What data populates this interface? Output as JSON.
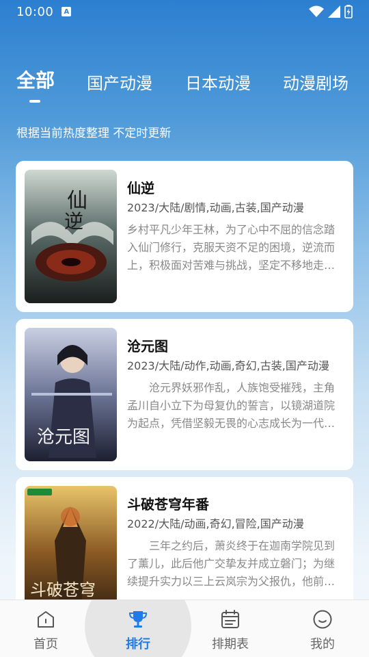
{
  "status_bar": {
    "time": "10:00",
    "notification_icon": "A"
  },
  "tabs": [
    {
      "label": "全部",
      "active": true
    },
    {
      "label": "国产动漫",
      "active": false
    },
    {
      "label": "日本动漫",
      "active": false
    },
    {
      "label": "动漫剧场",
      "active": false
    }
  ],
  "subtitle": "根据当前热度整理 不定时更新",
  "cards": [
    {
      "title": "仙逆",
      "meta": "2023/大陆/剧情,动画,古装,国产动漫",
      "description": "乡村平凡少年王林，为了心中不屈的信念踏入仙门修行，克服天资不足的困境，逆流而上，积极面对苦难与挑战，坚定不移地走向了属于自己的修仙之路。",
      "poster_colors": [
        "#1d2a2a",
        "#7a2b1e",
        "#c9d2cc"
      ]
    },
    {
      "title": "沧元图",
      "meta": "2023/大陆/动作,动画,奇幻,古装,国产动漫",
      "description": "沧元界妖邪作乱，人族饱受摧残，主角孟川自小立下为母复仇的誓言，以镜湖道院为起点，凭借坚毅无畏的心志成长为一代宗师。",
      "poster_colors": [
        "#2a2f4a",
        "#8a95b8",
        "#d9dde8"
      ]
    },
    {
      "title": "斗破苍穹年番",
      "meta": "2022/大陆/动画,奇幻,冒险,国产动漫",
      "description": "三年之约后，萧炎终于在迦南学院见到了薰儿，此后他广交挚友并成立磐门；为继续提升实力以三上云岚宗为父报仇，他前往天焚炼气塔修炼。",
      "poster_colors": [
        "#3b2a18",
        "#c98a2e",
        "#e8c46a"
      ]
    }
  ],
  "bottom_nav": [
    {
      "label": "首页",
      "icon": "home-icon",
      "active": false
    },
    {
      "label": "排行",
      "icon": "trophy-icon",
      "active": true
    },
    {
      "label": "排期表",
      "icon": "calendar-icon",
      "active": false
    },
    {
      "label": "我的",
      "icon": "smile-face-icon",
      "active": false
    }
  ],
  "colors": {
    "accent": "#1e7be8",
    "header_gradient_top": "#2c7fd0"
  }
}
